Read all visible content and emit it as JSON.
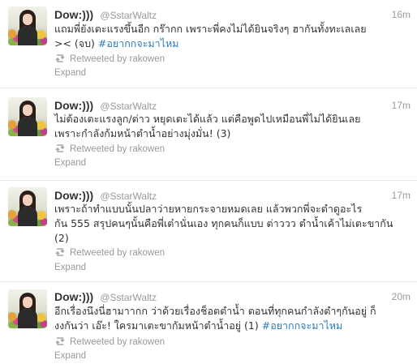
{
  "tweets": [
    {
      "display_name": "Dow:)))",
      "screen_name": "@SstarWaltz",
      "time": "16m",
      "lines": [
        [
          {
            "text": "แถมพี่ยังเตะแรงขึ้นอีก กร๊ากก เพราะพี่คงไม่ได้ยินจริงๆ ฮากันทั้งทะเลเลย"
          }
        ],
        [
          {
            "text": "><  (จบ) "
          },
          {
            "text": "#อยากกจะมาไหม",
            "hashtag": true
          }
        ]
      ],
      "retweeted_prefix": "Retweeted by",
      "retweeted_by": "rakowen",
      "expand": "Expand"
    },
    {
      "display_name": "Dow:)))",
      "screen_name": "@SstarWaltz",
      "time": "17m",
      "lines": [
        [
          {
            "text": "ไม่ต้องเตะแรงลูก/ต่าว หยุดเตะได้แล้ว แต่คือพูดไปเหมือนพี่ไม่ได้ยินเลย"
          }
        ],
        [
          {
            "text": "เพราะกำลังก้มหน้าตำน้ำอย่างมุ่งมั่น! (3)"
          }
        ]
      ],
      "retweeted_prefix": "Retweeted by",
      "retweeted_by": "rakowen",
      "expand": "Expand"
    },
    {
      "display_name": "Dow:)))",
      "screen_name": "@SstarWaltz",
      "time": "17m",
      "lines": [
        [
          {
            "text": "เพราะถ้าทำแบบนั้นปลาว่ายหายกระจายหมดเลย แล้วพวกพี่จะตำดูอะไร"
          }
        ],
        [
          {
            "text": "กัน 555 สรุปคนๆนั้นคือพี่เต๋านั่นเอง ทุกคนก็แบบ ต่าววว ตำน้ำเค้าไม่เตะขากัน"
          }
        ],
        [
          {
            "text": "(2)"
          }
        ]
      ],
      "retweeted_prefix": "Retweeted by",
      "retweeted_by": "rakowen",
      "expand": "Expand"
    },
    {
      "display_name": "Dow:)))",
      "screen_name": "@SstarWaltz",
      "time": "20m",
      "lines": [
        [
          {
            "text": "อีกเรื่องนึงนี่ฮามาากก ว่าด้วยเรื่องช็อตตำน้ำ ตอนที่ทุกคนกำลังตำๆกันอยู่ ก็"
          }
        ],
        [
          {
            "text": "งงกันว่า เอ๊ะ! ใครมาเตะขากัมหน้าตำน้ำอยู่ (1) "
          },
          {
            "text": "#อยากกจะมาไหม",
            "hashtag": true
          }
        ]
      ],
      "retweeted_prefix": "Retweeted by",
      "retweeted_by": "rakowen",
      "expand": "Expand"
    }
  ],
  "colors": {
    "text": "#333333",
    "muted": "#999999",
    "hashtag": "#2b7bb9",
    "divider": "#e8e8e8"
  },
  "icons": {
    "retweet": "retweet-icon",
    "avatar": "avatar"
  }
}
